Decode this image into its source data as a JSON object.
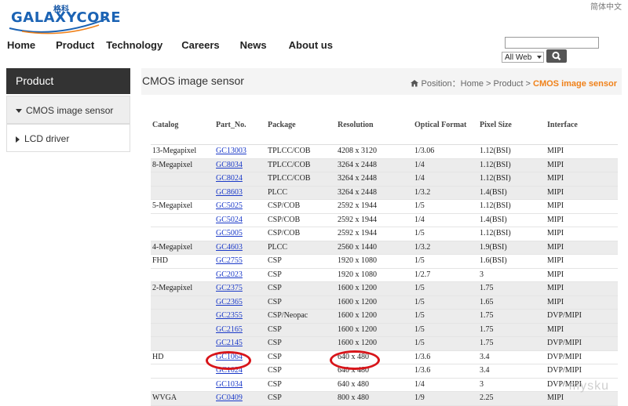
{
  "header": {
    "logo_cn": "格科",
    "logo_text": "GALAXYCORE",
    "lang_link": "简体中文",
    "nav": [
      "Home",
      "Product",
      "Technology",
      "Careers",
      "News",
      "About us"
    ],
    "search": {
      "input_value": "",
      "select_value": "All Web"
    }
  },
  "sidebar": {
    "heading": "Product",
    "items": [
      {
        "label": "CMOS image sensor",
        "active": true
      },
      {
        "label": "LCD driver",
        "active": false
      }
    ]
  },
  "content": {
    "title": "CMOS image sensor",
    "breadcrumb": {
      "prefix": "Position：",
      "home": "Home",
      "sep1": " > ",
      "product": "Product",
      "sep2": " > ",
      "current": "CMOS image sensor"
    }
  },
  "table": {
    "headers": [
      "Catalog",
      "Part_No.",
      "Package",
      "Resolution",
      "Optical Format",
      "Pixel Size",
      "Interface"
    ],
    "rows": [
      [
        "13-Megapixel",
        "GC13003",
        "TPLCC/COB",
        "4208 x 3120",
        "1/3.06",
        "1.12(BSI)",
        "MIPI"
      ],
      [
        "8-Megapixel",
        "GC8034",
        "TPLCC/COB",
        "3264 x 2448",
        "1/4",
        "1.12(BSI)",
        "MIPI"
      ],
      [
        "",
        "GC8024",
        "TPLCC/COB",
        "3264 x 2448",
        "1/4",
        "1.12(BSI)",
        "MIPI"
      ],
      [
        "",
        "GC8603",
        "PLCC",
        "3264 x 2448",
        "1/3.2",
        "1.4(BSI)",
        "MIPI"
      ],
      [
        "5-Megapixel",
        "GC5025",
        "CSP/COB",
        "2592 x 1944",
        "1/5",
        "1.12(BSI)",
        "MIPI"
      ],
      [
        "",
        "GC5024",
        "CSP/COB",
        "2592 x 1944",
        "1/4",
        "1.4(BSI)",
        "MIPI"
      ],
      [
        "",
        "GC5005",
        "CSP/COB",
        "2592 x 1944",
        "1/5",
        "1.12(BSI)",
        "MIPI"
      ],
      [
        "4-Megapixel",
        "GC4603",
        "PLCC",
        "2560 x 1440",
        "1/3.2",
        "1.9(BSI)",
        "MIPI"
      ],
      [
        "FHD",
        "GC2755",
        "CSP",
        "1920 x 1080",
        "1/5",
        "1.6(BSI)",
        "MIPI"
      ],
      [
        "",
        "GC2023",
        "CSP",
        "1920 x 1080",
        "1/2.7",
        "3",
        "MIPI"
      ],
      [
        "2-Megapixel",
        "GC2375",
        "CSP",
        "1600 x 1200",
        "1/5",
        "1.75",
        "MIPI"
      ],
      [
        "",
        "GC2365",
        "CSP",
        "1600 x 1200",
        "1/5",
        "1.65",
        "MIPI"
      ],
      [
        "",
        "GC2355",
        "CSP/Neopac",
        "1600 x 1200",
        "1/5",
        "1.75",
        "DVP/MIPI"
      ],
      [
        "",
        "GC2165",
        "CSP",
        "1600 x 1200",
        "1/5",
        "1.75",
        "MIPI"
      ],
      [
        "",
        "GC2145",
        "CSP",
        "1600 x 1200",
        "1/5",
        "1.75",
        "DVP/MIPI"
      ],
      [
        "HD",
        "GC1064",
        "CSP",
        "640 x 480",
        "1/3.6",
        "3.4",
        "DVP/MIPI"
      ],
      [
        "",
        "GC1024",
        "CSP",
        "640 x 480",
        "1/3.6",
        "3.4",
        "DVP/MIPI"
      ],
      [
        "",
        "GC1034",
        "CSP",
        "640 x 480",
        "1/4",
        "3",
        "DVP/MIPI"
      ],
      [
        "WVGA",
        "GC0409",
        "CSP",
        "800 x 480",
        "1/9",
        "2.25",
        "MIPI"
      ]
    ],
    "shaded_groups": [
      "8-Megapixel",
      "4-Megapixel",
      "2-Megapixel",
      "WVGA"
    ]
  },
  "colors": {
    "accent": "#f08119",
    "link": "#1a39c8",
    "sidebar_head": "#333333",
    "annotation": "#d8151a"
  },
  "watermark": "mysku"
}
